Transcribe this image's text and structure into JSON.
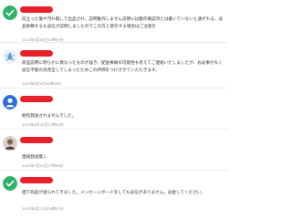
{
  "reviews": [
    {
      "avatar_icon": "green-check-avatar-icon",
      "avatar_color": "#2fb36a",
      "text": "前立った傷や汚れ無しで出品され、説明動作しません説明には動作確認済とは書いていないと通ずれる、返品依頼するも返信が説明しましたのでこの方と取引する場合はご注意を",
      "time": "2023年8月08日10時59分"
    },
    {
      "avatar_icon": "splash-avatar-icon",
      "avatar_color": "#6aa0d8",
      "text": "商品説明に明らかに異なったものが届き、配送事故の可能性も考えてご連絡いたしましたが、お返事がなく返信不能の為完全してしまったためこの評価をつけさせていただきます。",
      "time": "2023年8月4日04時59分"
    },
    {
      "avatar_icon": "default-user-avatar-icon",
      "avatar_color": "#2f6fd6",
      "text": "梱包発送されませんでした。",
      "time": "2023年8月30日17時30分"
    },
    {
      "avatar_icon": "photo-avatar-icon",
      "avatar_color": "#8a6a5a",
      "text": "連絡発送無し",
      "time": "2023年7月22日17時58分"
    },
    {
      "avatar_icon": "green-check-avatar-icon",
      "avatar_color": "#2fb36a",
      "text": "値下商品が送られてきました。メッセージボードをしても返信がありません。返金してください。",
      "time": "2023年8月22日20時42分"
    }
  ]
}
